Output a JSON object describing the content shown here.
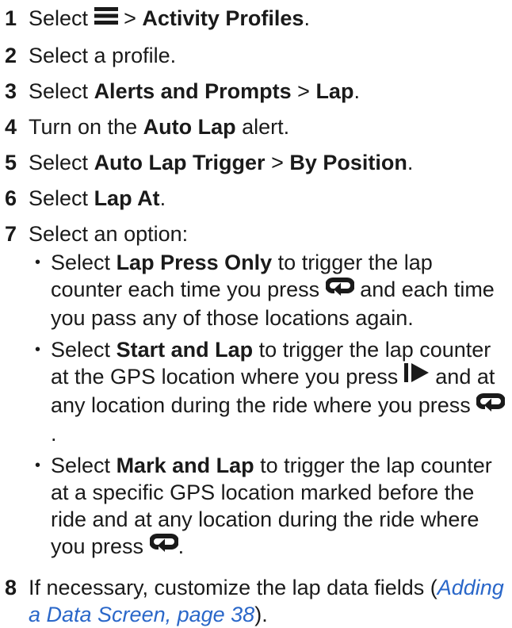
{
  "steps": [
    {
      "num": "1",
      "pre": "Select",
      "after_icon": ">",
      "bold1": "Activity Profiles",
      "end": ".",
      "icon": "menu-icon"
    },
    {
      "num": "2",
      "text": "Select a profile."
    },
    {
      "num": "3",
      "pre": "Select",
      "bold1": "Alerts and Prompts",
      "sep": ">",
      "bold2": "Lap",
      "end": "."
    },
    {
      "num": "4",
      "pre": "Turn on the",
      "bold1": "Auto Lap",
      "post": "alert."
    },
    {
      "num": "5",
      "pre": "Select",
      "bold1": "Auto Lap Trigger",
      "sep": ">",
      "bold2": "By Position",
      "end": "."
    },
    {
      "num": "6",
      "pre": "Select",
      "bold1": "Lap At",
      "end": "."
    },
    {
      "num": "7",
      "text": "Select an option:"
    },
    {
      "num": "8",
      "pre": "If necessary, customize the lap data fields (",
      "link": "Adding a Data Screen, page 38",
      "end": ")."
    }
  ],
  "options": [
    {
      "pre": "Select",
      "bold": "Lap Press Only",
      "text1": "to trigger the lap counter each time you press",
      "icon1": "lap-icon",
      "text2": "and each time you pass any of those locations again."
    },
    {
      "pre": "Select",
      "bold": "Start and Lap",
      "text1": "to trigger the lap counter at the GPS location where you press",
      "icon1": "start-icon",
      "text2": "and at any location during the ride where you press",
      "icon2": "lap-icon",
      "end": "."
    },
    {
      "pre": "Select",
      "bold": "Mark and Lap",
      "text1": "to trigger the lap counter at a specific GPS location marked before the ride and at any location during the ride where you press",
      "icon1": "lap-icon",
      "end": "."
    }
  ],
  "bullet_char": "•"
}
